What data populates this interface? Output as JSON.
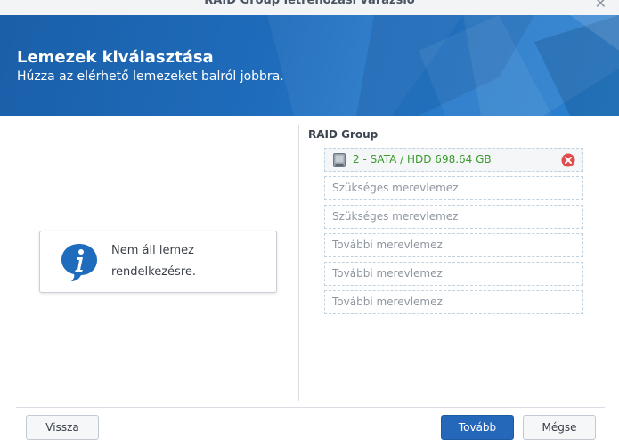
{
  "window": {
    "title": "RAID Group létrehozási varázsló",
    "close_icon": "close-icon"
  },
  "header": {
    "title": "Lemezek kiválasztása",
    "subtitle": "Húzza az elérhető lemezeket balról jobbra."
  },
  "available_panel": {
    "message": "Nem áll lemez rendelkezésre.",
    "icon": "info-icon"
  },
  "raid_group": {
    "label": "RAID Group",
    "selected_disk": {
      "label": "2 - SATA / HDD 698.64 GB",
      "icon": "hdd-icon",
      "remove_icon": "remove-icon"
    },
    "slots": [
      "Szükséges merevlemez",
      "Szükséges merevlemez",
      "További merevlemez",
      "További merevlemez",
      "További merevlemez"
    ]
  },
  "footer": {
    "back_label": "Vissza",
    "next_label": "Tovább",
    "cancel_label": "Mégse"
  },
  "colors": {
    "header_blue": "#1f6cbc",
    "primary_button": "#2567b8",
    "disk_text": "#3a9a2c",
    "remove_red": "#e04b4b"
  }
}
